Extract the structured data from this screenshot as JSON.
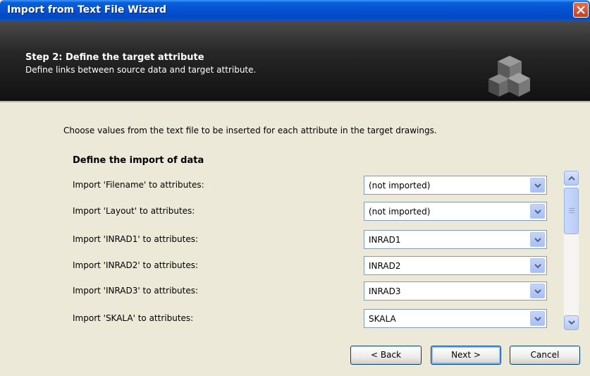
{
  "window": {
    "title": "Import from Text File Wizard"
  },
  "banner": {
    "title": "Step 2: Define the target attribute",
    "subtitle": "Define links between source data and target attribute."
  },
  "body": {
    "intro": "Choose values from the text file to be inserted for each attribute in the target drawings.",
    "section_title": "Define the import of data",
    "rows": [
      {
        "label": "Import 'Filename' to attributes:",
        "value": "(not imported)"
      },
      {
        "label": "Import 'Layout' to attributes:",
        "value": "(not imported)"
      },
      {
        "label": "Import 'INRAD1' to attributes:",
        "value": "INRAD1"
      },
      {
        "label": "Import 'INRAD2' to attributes:",
        "value": "INRAD2"
      },
      {
        "label": "Import 'INRAD3' to attributes:",
        "value": "INRAD3"
      },
      {
        "label": "Import 'SKALA' to attributes:",
        "value": "SKALA"
      }
    ]
  },
  "buttons": {
    "back": "< Back",
    "next": "Next >",
    "cancel": "Cancel"
  },
  "icons": {
    "close": "close-icon",
    "logo": "cubes-logo-icon",
    "dropdown": "chevron-down-icon",
    "scroll_up": "scroll-up-arrow-icon",
    "scroll_down": "scroll-down-arrow-icon"
  },
  "colors": {
    "titlebar": "#0453d2",
    "banner": "#262626",
    "background": "#ece9d8"
  }
}
